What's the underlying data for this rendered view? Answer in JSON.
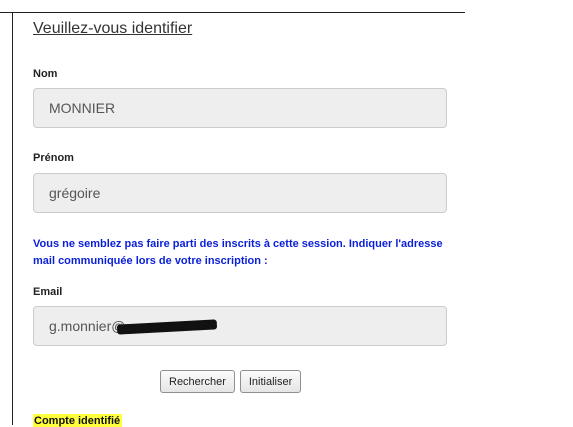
{
  "form": {
    "title": "Veuillez-vous identifier",
    "nom": {
      "label": "Nom",
      "value": "MONNIER"
    },
    "prenom": {
      "label": "Prénom",
      "value": "grégoire"
    },
    "notice": "Vous ne semblez pas faire parti des inscrits à cette session. Indiquer l'adresse mail communiquée lors de votre inscription :",
    "email": {
      "label": "Email",
      "value": "g.monnier@"
    },
    "buttons": {
      "search_label": "Rechercher",
      "reset_label": "Initialiser"
    },
    "status": "Compte identifié"
  },
  "colors": {
    "notice_text": "#0a1fd8",
    "status_highlight": "#ffff3c",
    "input_background": "#eeeeee"
  }
}
